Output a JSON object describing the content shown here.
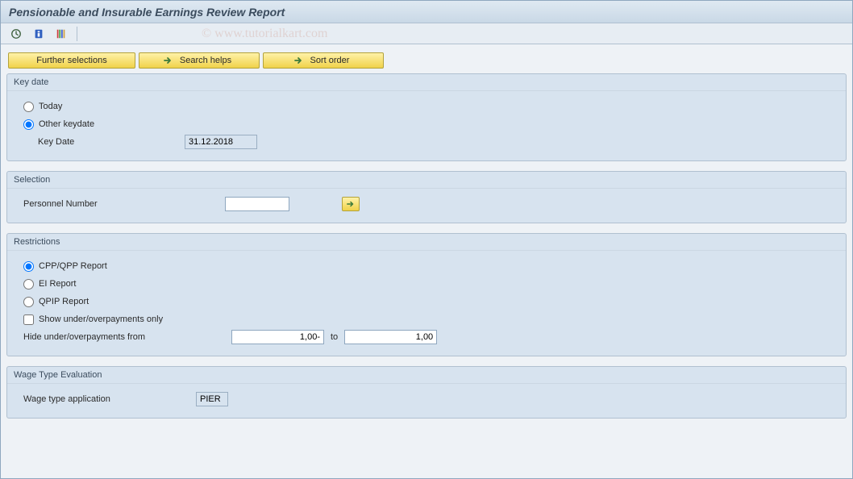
{
  "title": "Pensionable and Insurable Earnings Review Report",
  "watermark": "© www.tutorialkart.com",
  "buttons": {
    "further_selections": "Further selections",
    "search_helps": "Search helps",
    "sort_order": "Sort order"
  },
  "groups": {
    "keydate": {
      "title": "Key date",
      "today": "Today",
      "other": "Other keydate",
      "keydate_label": "Key Date",
      "keydate_value": "31.12.2018"
    },
    "selection": {
      "title": "Selection",
      "personnel_number": "Personnel Number",
      "personnel_value": ""
    },
    "restrictions": {
      "title": "Restrictions",
      "cpp": "CPP/QPP Report",
      "ei": "EI Report",
      "qpip": "QPIP Report",
      "show_overunder": "Show under/overpayments only",
      "hide_label": "Hide under/overpayments from",
      "from_value": "1,00-",
      "to_label": "to",
      "to_value": "1,00"
    },
    "wagetype": {
      "title": "Wage Type Evaluation",
      "app_label": "Wage type application",
      "app_value": "PIER"
    }
  }
}
